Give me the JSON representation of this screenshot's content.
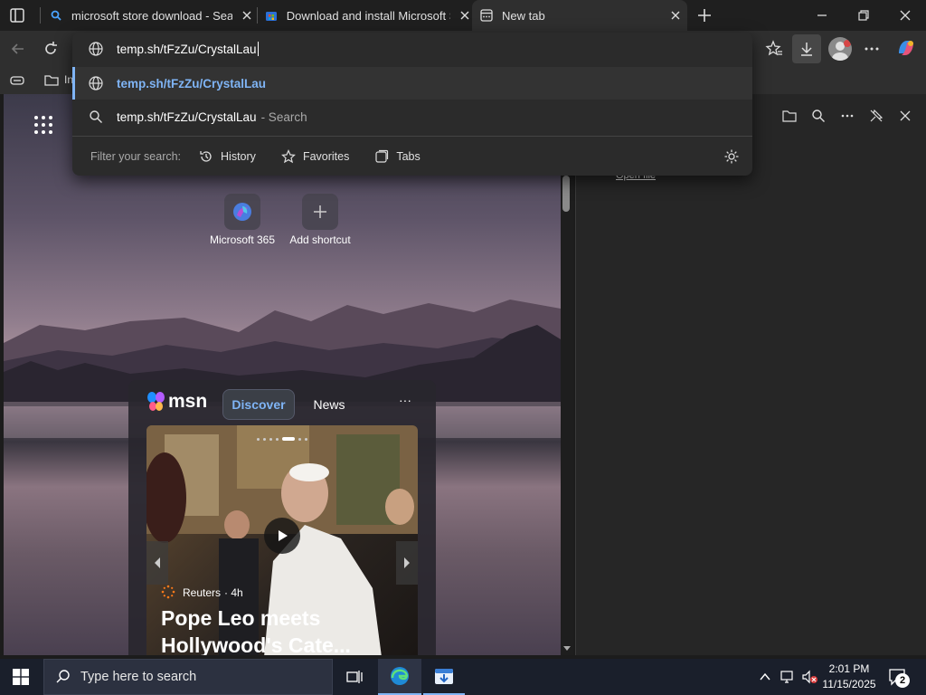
{
  "tabs": [
    {
      "title": "microsoft store download - Search",
      "active": false
    },
    {
      "title": "Download and install Microsoft Store",
      "active": false
    },
    {
      "title": "New tab",
      "active": true
    }
  ],
  "omnibox": {
    "input_value": "temp.sh/tFzZu/CrystalLau",
    "suggestion_url": "temp.sh/tFzZu/CrystalLau",
    "suggestion_search": "temp.sh/tFzZu/CrystalLau",
    "suggestion_search_suffix": "- Search",
    "filter_label": "Filter your search:",
    "filters": [
      "History",
      "Favorites",
      "Tabs"
    ]
  },
  "favorites_bar": {
    "item_partial": "In"
  },
  "downloads_panel": {
    "open_file_link": "Open file"
  },
  "shortcuts": [
    {
      "label": "Microsoft 365",
      "icon": "microsoft-365-icon"
    },
    {
      "label": "Add shortcut",
      "icon": "plus-icon"
    }
  ],
  "msn": {
    "logo": "msn",
    "tabs": [
      "Discover",
      "News"
    ],
    "active_tab": "Discover",
    "more": "···",
    "article": {
      "source": "Reuters",
      "age": "· 4h",
      "headline": "Pope Leo meets Hollywood's Cate..."
    }
  },
  "taskbar": {
    "search_placeholder": "Type here to search",
    "time": "2:01 PM",
    "date": "11/15/2025",
    "notification_count": "2"
  },
  "colors": {
    "accent": "#7fb4f5",
    "chip_active": "#3b3f47",
    "taskbar": "#1a1f2b"
  }
}
